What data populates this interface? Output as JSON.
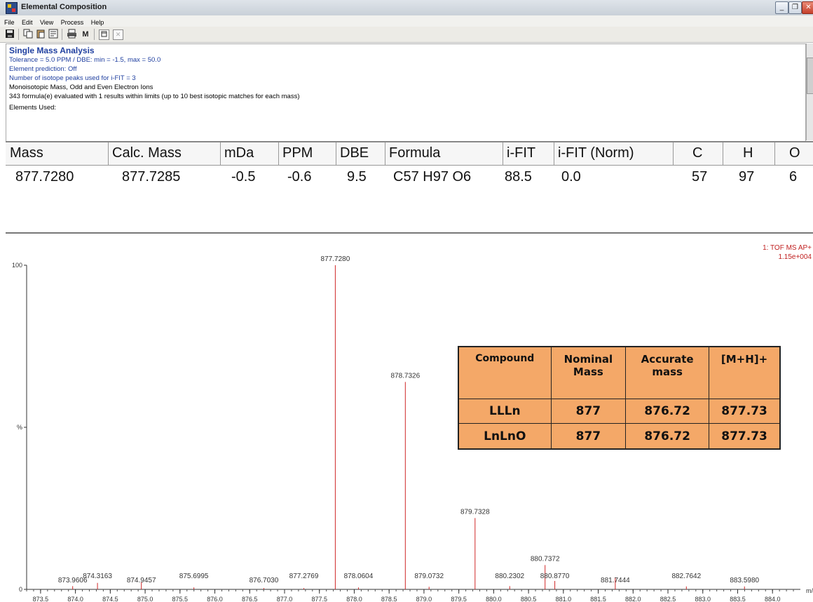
{
  "window": {
    "title": "Elemental Composition"
  },
  "menu": [
    "File",
    "Edit",
    "View",
    "Process",
    "Help"
  ],
  "toolbar_icons": [
    "save-icon",
    "copy-icon",
    "paste-icon",
    "properties-icon",
    "print-icon",
    "mass-icon",
    "window-icon",
    "close-doc-icon"
  ],
  "toolbar_labels": {
    "mass": "M"
  },
  "info": {
    "title": "Single Mass Analysis",
    "lines": [
      "Tolerance = 5.0 PPM   /   DBE: min = -1.5, max = 50.0",
      "Element prediction: Off",
      "Number of isotope peaks used for i-FIT = 3",
      "Monoisotopic Mass, Odd and Even Electron Ions",
      "343 formula(e) evaluated with 1 results within limits (up to 10 best isotopic matches for each mass)",
      "Elements Used:"
    ]
  },
  "results": {
    "headers": [
      "Mass",
      "Calc. Mass",
      "mDa",
      "PPM",
      "DBE",
      "Formula",
      "i-FIT",
      "i-FIT (Norm)",
      "C",
      "H",
      "O"
    ],
    "row": [
      "877.7280",
      "877.7285",
      "-0.5",
      "-0.6",
      "9.5",
      "C57  H97  O6",
      "88.5",
      "0.0",
      "57",
      "97",
      "6"
    ]
  },
  "plot": {
    "header": [
      "1: TOF MS AP+",
      "1.15e+004"
    ],
    "color": "#d02828",
    "xaxis_label": "m/z"
  },
  "chart_data": {
    "type": "bar",
    "xlim": [
      873.3,
      884.4
    ],
    "ylim": [
      0,
      100
    ],
    "y_ticks": [
      {
        "label": "100",
        "value": 100
      },
      {
        "label": "%",
        "value": 50
      },
      {
        "label": "0",
        "value": 0
      }
    ],
    "x_ticks": [
      "873.5",
      "874.0",
      "874.5",
      "875.0",
      "875.5",
      "876.0",
      "876.5",
      "877.0",
      "877.5",
      "878.0",
      "878.5",
      "879.0",
      "879.5",
      "880.0",
      "880.5",
      "881.0",
      "881.5",
      "882.0",
      "882.5",
      "883.0",
      "883.5",
      "884.0"
    ],
    "peaks": [
      {
        "x": 873.9606,
        "y": 1.0,
        "label": "873.9606"
      },
      {
        "x": 874.3163,
        "y": 2.0,
        "label": "874.3163"
      },
      {
        "x": 874.9457,
        "y": 2.2,
        "label": "874.9457"
      },
      {
        "x": 875.6995,
        "y": 0.6,
        "label": "875.6995"
      },
      {
        "x": 876.703,
        "y": 0.4,
        "label": "876.7030"
      },
      {
        "x": 877.2769,
        "y": 0.4,
        "label": "877.2769"
      },
      {
        "x": 877.728,
        "y": 100,
        "label": "877.7280"
      },
      {
        "x": 878.0604,
        "y": 0.6,
        "label": "878.0604"
      },
      {
        "x": 878.7326,
        "y": 64,
        "label": "878.7326"
      },
      {
        "x": 879.0732,
        "y": 0.8,
        "label": "879.0732"
      },
      {
        "x": 879.7328,
        "y": 22,
        "label": "879.7328"
      },
      {
        "x": 880.2302,
        "y": 1.0,
        "label": "880.2302"
      },
      {
        "x": 880.7372,
        "y": 7.5,
        "label": "880.7372"
      },
      {
        "x": 880.877,
        "y": 2.6,
        "label": "880.8770"
      },
      {
        "x": 881.7444,
        "y": 3.7,
        "label": "881.7444"
      },
      {
        "x": 882.7642,
        "y": 0.9,
        "label": "882.7642"
      },
      {
        "x": 883.598,
        "y": 0.9,
        "label": "883.5980"
      }
    ]
  },
  "compound_table": {
    "headers": [
      "Compound",
      "Nominal\nMass",
      "Accurate\nmass",
      "[M+H]+"
    ],
    "rows": [
      [
        "LLLn",
        "877",
        "876.72",
        "877.73"
      ],
      [
        "LnLnO",
        "877",
        "876.72",
        "877.73"
      ]
    ]
  }
}
